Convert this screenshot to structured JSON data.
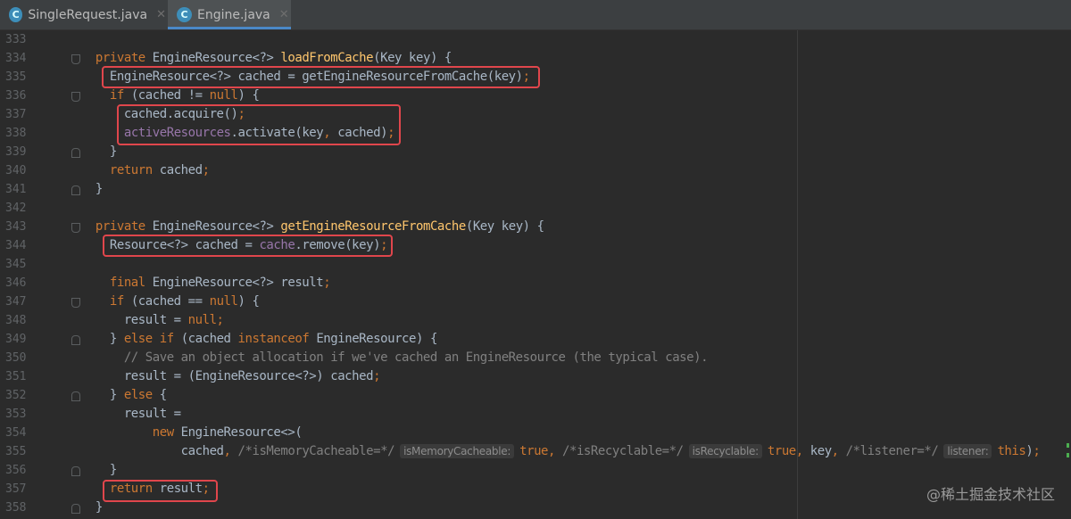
{
  "tabs": [
    {
      "label": "SingleRequest.java",
      "icon": "C",
      "active": false
    },
    {
      "label": "Engine.java",
      "icon": "C",
      "active": true
    }
  ],
  "watermark": "@稀土掘金技术社区",
  "lines": [
    {
      "n": "333",
      "tokens": []
    },
    {
      "n": "334",
      "fold": "down",
      "tokens": [
        [
          "t",
          "    "
        ],
        [
          "k",
          "private "
        ],
        [
          "t",
          "EngineResource<?> "
        ],
        [
          "m",
          "loadFromCache"
        ],
        [
          "t",
          "(Key key) {"
        ]
      ]
    },
    {
      "n": "335",
      "tokens": [
        [
          "t",
          "      EngineResource<?> cached = getEngineResourceFromCache(key)"
        ],
        [
          "k",
          ";"
        ]
      ]
    },
    {
      "n": "336",
      "fold": "down",
      "tokens": [
        [
          "t",
          "      "
        ],
        [
          "k",
          "if "
        ],
        [
          "t",
          "(cached != "
        ],
        [
          "k",
          "null"
        ],
        [
          "t",
          ") {"
        ]
      ]
    },
    {
      "n": "337",
      "tokens": [
        [
          "t",
          "        cached.acquire()"
        ],
        [
          "k",
          ";"
        ]
      ]
    },
    {
      "n": "338",
      "tokens": [
        [
          "t",
          "        "
        ],
        [
          "f",
          "activeResources"
        ],
        [
          "t",
          ".activate(key"
        ],
        [
          "k",
          ", "
        ],
        [
          "t",
          "cached)"
        ],
        [
          "k",
          ";"
        ]
      ]
    },
    {
      "n": "339",
      "fold": "up",
      "tokens": [
        [
          "t",
          "      }"
        ]
      ]
    },
    {
      "n": "340",
      "tokens": [
        [
          "t",
          "      "
        ],
        [
          "k",
          "return "
        ],
        [
          "t",
          "cached"
        ],
        [
          "k",
          ";"
        ]
      ]
    },
    {
      "n": "341",
      "fold": "up",
      "tokens": [
        [
          "t",
          "    }"
        ]
      ]
    },
    {
      "n": "342",
      "tokens": []
    },
    {
      "n": "343",
      "fold": "down",
      "tokens": [
        [
          "t",
          "    "
        ],
        [
          "k",
          "private "
        ],
        [
          "t",
          "EngineResource<?> "
        ],
        [
          "m",
          "getEngineResourceFromCache"
        ],
        [
          "t",
          "(Key key) {"
        ]
      ]
    },
    {
      "n": "344",
      "tokens": [
        [
          "t",
          "      Resource<?> cached = "
        ],
        [
          "f",
          "cache"
        ],
        [
          "t",
          ".remove(key)"
        ],
        [
          "k",
          ";"
        ]
      ]
    },
    {
      "n": "345",
      "tokens": []
    },
    {
      "n": "346",
      "tokens": [
        [
          "t",
          "      "
        ],
        [
          "k",
          "final "
        ],
        [
          "t",
          "EngineResource<?> result"
        ],
        [
          "k",
          ";"
        ]
      ]
    },
    {
      "n": "347",
      "fold": "down",
      "tokens": [
        [
          "t",
          "      "
        ],
        [
          "k",
          "if "
        ],
        [
          "t",
          "(cached == "
        ],
        [
          "k",
          "null"
        ],
        [
          "t",
          ") {"
        ]
      ]
    },
    {
      "n": "348",
      "tokens": [
        [
          "t",
          "        result = "
        ],
        [
          "k",
          "null;"
        ]
      ]
    },
    {
      "n": "349",
      "fold": "up",
      "tokens": [
        [
          "t",
          "      } "
        ],
        [
          "k",
          "else if "
        ],
        [
          "t",
          "(cached "
        ],
        [
          "k",
          "instanceof "
        ],
        [
          "t",
          "EngineResource) {"
        ]
      ]
    },
    {
      "n": "350",
      "tokens": [
        [
          "c",
          "        // Save an object allocation if we've cached an EngineResource (the typical case)."
        ]
      ]
    },
    {
      "n": "351",
      "tokens": [
        [
          "t",
          "        result = (EngineResource<?>) cached"
        ],
        [
          "k",
          ";"
        ]
      ]
    },
    {
      "n": "352",
      "fold": "up",
      "tokens": [
        [
          "t",
          "      } "
        ],
        [
          "k",
          "else "
        ],
        [
          "t",
          "{"
        ]
      ]
    },
    {
      "n": "353",
      "tokens": [
        [
          "t",
          "        result ="
        ]
      ]
    },
    {
      "n": "354",
      "tokens": [
        [
          "t",
          "            "
        ],
        [
          "k",
          "new "
        ],
        [
          "t",
          "EngineResource<>("
        ]
      ]
    },
    {
      "n": "355",
      "tokens": [
        [
          "t",
          "                cached"
        ],
        [
          "k",
          ", "
        ],
        [
          "c",
          "/*isMemoryCacheable=*/"
        ],
        [
          "h",
          "isMemoryCacheable:"
        ],
        [
          "k",
          "true, "
        ],
        [
          "c",
          "/*isRecyclable=*/"
        ],
        [
          "h",
          "isRecyclable:"
        ],
        [
          "k",
          "true, "
        ],
        [
          "t",
          "key"
        ],
        [
          "k",
          ", "
        ],
        [
          "c",
          "/*listener=*/"
        ],
        [
          "h",
          "listener:"
        ],
        [
          "k",
          "this"
        ],
        [
          "t",
          ")"
        ],
        [
          "k",
          ";"
        ]
      ]
    },
    {
      "n": "356",
      "fold": "up",
      "tokens": [
        [
          "t",
          "      }"
        ]
      ]
    },
    {
      "n": "357",
      "tokens": [
        [
          "t",
          "      "
        ],
        [
          "k",
          "return "
        ],
        [
          "t",
          "result"
        ],
        [
          "k",
          ";"
        ]
      ]
    },
    {
      "n": "358",
      "fold": "up",
      "tokens": [
        [
          "t",
          "    }"
        ]
      ]
    }
  ]
}
